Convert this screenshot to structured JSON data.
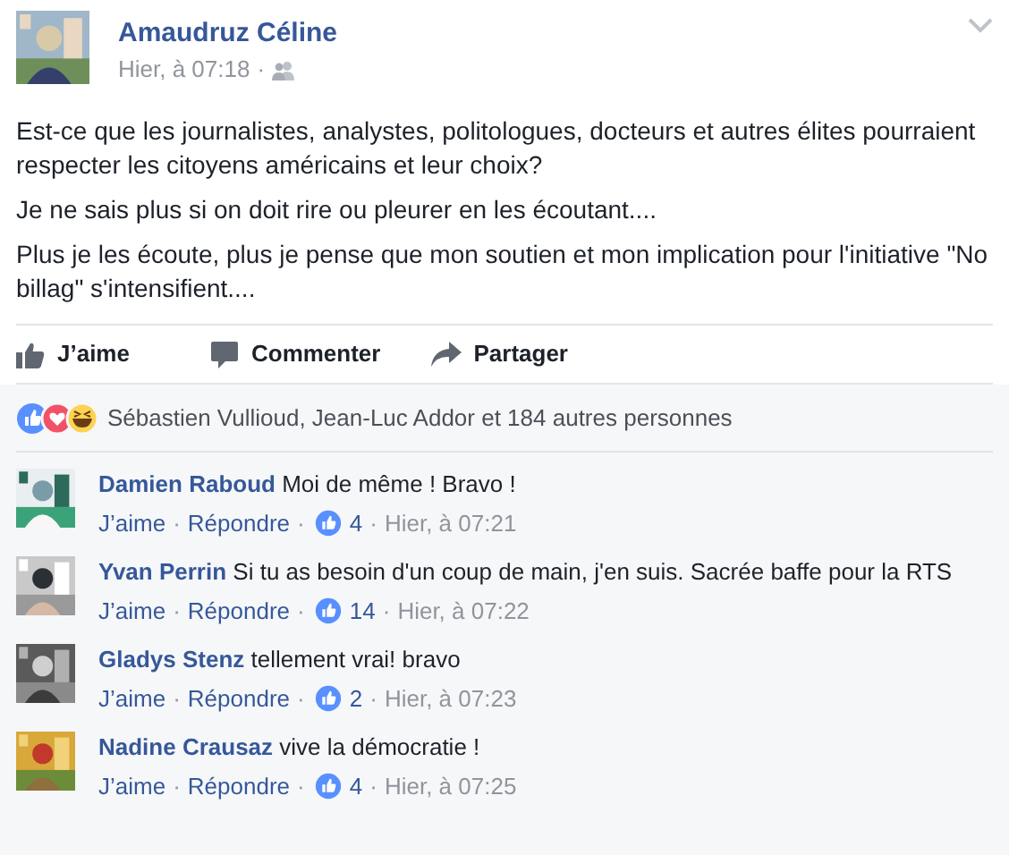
{
  "post": {
    "author": "Amaudruz Céline",
    "time": "Hier, à 07:18",
    "separator": "·",
    "paragraphs": [
      "Est-ce que les journalistes, analystes, politologues, docteurs et autres élites pourraient respecter les citoyens américains et leur choix?",
      "Je ne sais plus si on doit rire ou pleurer en les écoutant....",
      "Plus je les écoute, plus je pense que mon soutien et mon implication pour l'initiative \"No billag\" s'intensifient...."
    ]
  },
  "actions": [
    {
      "kind": "like",
      "label": "J’aime"
    },
    {
      "kind": "comment",
      "label": "Commenter"
    },
    {
      "kind": "share",
      "label": "Partager"
    }
  ],
  "reactions": {
    "text": "Sébastien Vullioud, Jean-Luc Addor et 184 autres personnes"
  },
  "comments": [
    {
      "author": "Damien Raboud",
      "text": "Moi de même ! Bravo !",
      "like": "J’aime",
      "reply": "Répondre",
      "likes": "4",
      "time": "Hier, à 07:21"
    },
    {
      "author": "Yvan Perrin",
      "text": "Si tu as besoin d'un coup de main, j'en suis. Sacrée baffe pour la RTS",
      "like": "J’aime",
      "reply": "Répondre",
      "likes": "14",
      "time": "Hier, à 07:22"
    },
    {
      "author": "Gladys Stenz",
      "text": "tellement vrai! bravo",
      "like": "J’aime",
      "reply": "Répondre",
      "likes": "2",
      "time": "Hier, à 07:23"
    },
    {
      "author": "Nadine Crausaz",
      "text": "vive la démocratie !",
      "like": "J’aime",
      "reply": "Répondre",
      "likes": "4",
      "time": "Hier, à 07:25"
    }
  ]
}
